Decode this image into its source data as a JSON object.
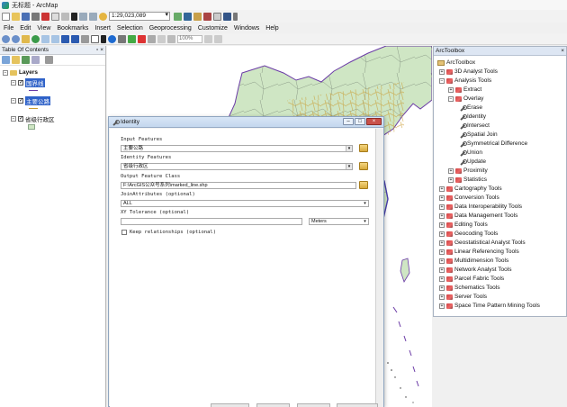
{
  "window": {
    "title": "无标题 - ArcMap"
  },
  "toolbar": {
    "scale": "1:29,023,089",
    "zoom": "100%"
  },
  "menu": [
    "File",
    "Edit",
    "View",
    "Bookmarks",
    "Insert",
    "Selection",
    "Geoprocessing",
    "Customize",
    "Windows",
    "Help"
  ],
  "toc": {
    "title": "Table Of Contents",
    "pin": "▫ ×",
    "root": "Layers",
    "layers": [
      {
        "name": "国界线",
        "selected": true
      },
      {
        "name": "主要公路",
        "selected": true
      },
      {
        "name": "省级行政区",
        "selected": false
      }
    ]
  },
  "dialog": {
    "title": "Identity",
    "input_label": "Input Features",
    "input_value": "主要公路",
    "identity_label": "Identity Features",
    "identity_value": "省级行政区",
    "output_label": "Output Feature Class",
    "output_value": "F:\\ArcGIS公众号系列\\marked_line.shp",
    "join_label": "JoinAttributes (optional)",
    "join_value": "ALL",
    "xy_label": "XY Tolerance (optional)",
    "xy_value": "",
    "xy_units": "Meters",
    "keep_label": "Keep relationships (optional)"
  },
  "toolbox": {
    "title": "ArcToolbox",
    "pin": "× ",
    "items": [
      {
        "label": "ArcToolbox",
        "level": 0,
        "kind": "root"
      },
      {
        "label": "3D Analyst Tools",
        "level": 1,
        "kind": "box",
        "exp": "+"
      },
      {
        "label": "Analysis Tools",
        "level": 1,
        "kind": "box",
        "exp": "−"
      },
      {
        "label": "Extract",
        "level": 2,
        "kind": "box",
        "exp": "+"
      },
      {
        "label": "Overlay",
        "level": 2,
        "kind": "box",
        "exp": "−"
      },
      {
        "label": "Erase",
        "level": 3,
        "kind": "tool"
      },
      {
        "label": "Identity",
        "level": 3,
        "kind": "tool",
        "active": true
      },
      {
        "label": "Intersect",
        "level": 3,
        "kind": "tool"
      },
      {
        "label": "Spatial Join",
        "level": 3,
        "kind": "tool"
      },
      {
        "label": "Symmetrical Difference",
        "level": 3,
        "kind": "tool"
      },
      {
        "label": "Union",
        "level": 3,
        "kind": "tool"
      },
      {
        "label": "Update",
        "level": 3,
        "kind": "tool"
      },
      {
        "label": "Proximity",
        "level": 2,
        "kind": "box",
        "exp": "+"
      },
      {
        "label": "Statistics",
        "level": 2,
        "kind": "box",
        "exp": "+"
      },
      {
        "label": "Cartography Tools",
        "level": 1,
        "kind": "box",
        "exp": "+"
      },
      {
        "label": "Conversion Tools",
        "level": 1,
        "kind": "box",
        "exp": "+"
      },
      {
        "label": "Data Interoperability Tools",
        "level": 1,
        "kind": "box",
        "exp": "+"
      },
      {
        "label": "Data Management Tools",
        "level": 1,
        "kind": "box",
        "exp": "+"
      },
      {
        "label": "Editing Tools",
        "level": 1,
        "kind": "box",
        "exp": "+"
      },
      {
        "label": "Geocoding Tools",
        "level": 1,
        "kind": "box",
        "exp": "+"
      },
      {
        "label": "Geostatistical Analyst Tools",
        "level": 1,
        "kind": "box",
        "exp": "+"
      },
      {
        "label": "Linear Referencing Tools",
        "level": 1,
        "kind": "box",
        "exp": "+"
      },
      {
        "label": "Multidimension Tools",
        "level": 1,
        "kind": "box",
        "exp": "+"
      },
      {
        "label": "Network Analyst Tools",
        "level": 1,
        "kind": "box",
        "exp": "+"
      },
      {
        "label": "Parcel Fabric Tools",
        "level": 1,
        "kind": "box",
        "exp": "+"
      },
      {
        "label": "Schematics Tools",
        "level": 1,
        "kind": "box",
        "exp": "+"
      },
      {
        "label": "Server Tools",
        "level": 1,
        "kind": "box",
        "exp": "+"
      },
      {
        "label": "Space Time Pattern Mining Tools",
        "level": 1,
        "kind": "box",
        "exp": "+"
      }
    ]
  },
  "colors": {
    "selection": "#2f62c8",
    "land": "#cfe6c4",
    "border": "#6a3aa6",
    "road": "#c99a2e"
  }
}
